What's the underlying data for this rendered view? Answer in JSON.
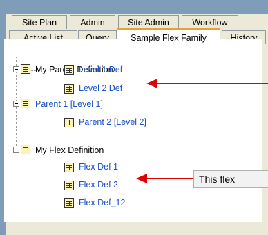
{
  "tabs_row1": [
    {
      "label": "Site Plan"
    },
    {
      "label": "Admin"
    },
    {
      "label": "Site Admin"
    },
    {
      "label": "Workflow"
    }
  ],
  "tabs_row2": [
    {
      "label": "Active List"
    },
    {
      "label": "Query"
    },
    {
      "label": "Sample Flex Family",
      "active": true
    },
    {
      "label": "History"
    }
  ],
  "tree": {
    "my_parent_definition": "My Parent Definition",
    "level_1_def": "Level 1 Def",
    "level_2_def": "Level 2 Def",
    "parent_1": "Parent 1 [Level 1]",
    "parent_2": "Parent 2 [Level 2]",
    "my_flex_definition": "My Flex Definition",
    "flex_def_1": "Flex Def 1",
    "flex_def_2": "Flex Def 2",
    "flex_def_12": "Flex Def_12"
  },
  "callout": {
    "text": "This flex"
  },
  "colors": {
    "link_blue": "#1a52c8",
    "arrow_red": "#e00000",
    "active_tab_accent": "#e3a23a"
  }
}
